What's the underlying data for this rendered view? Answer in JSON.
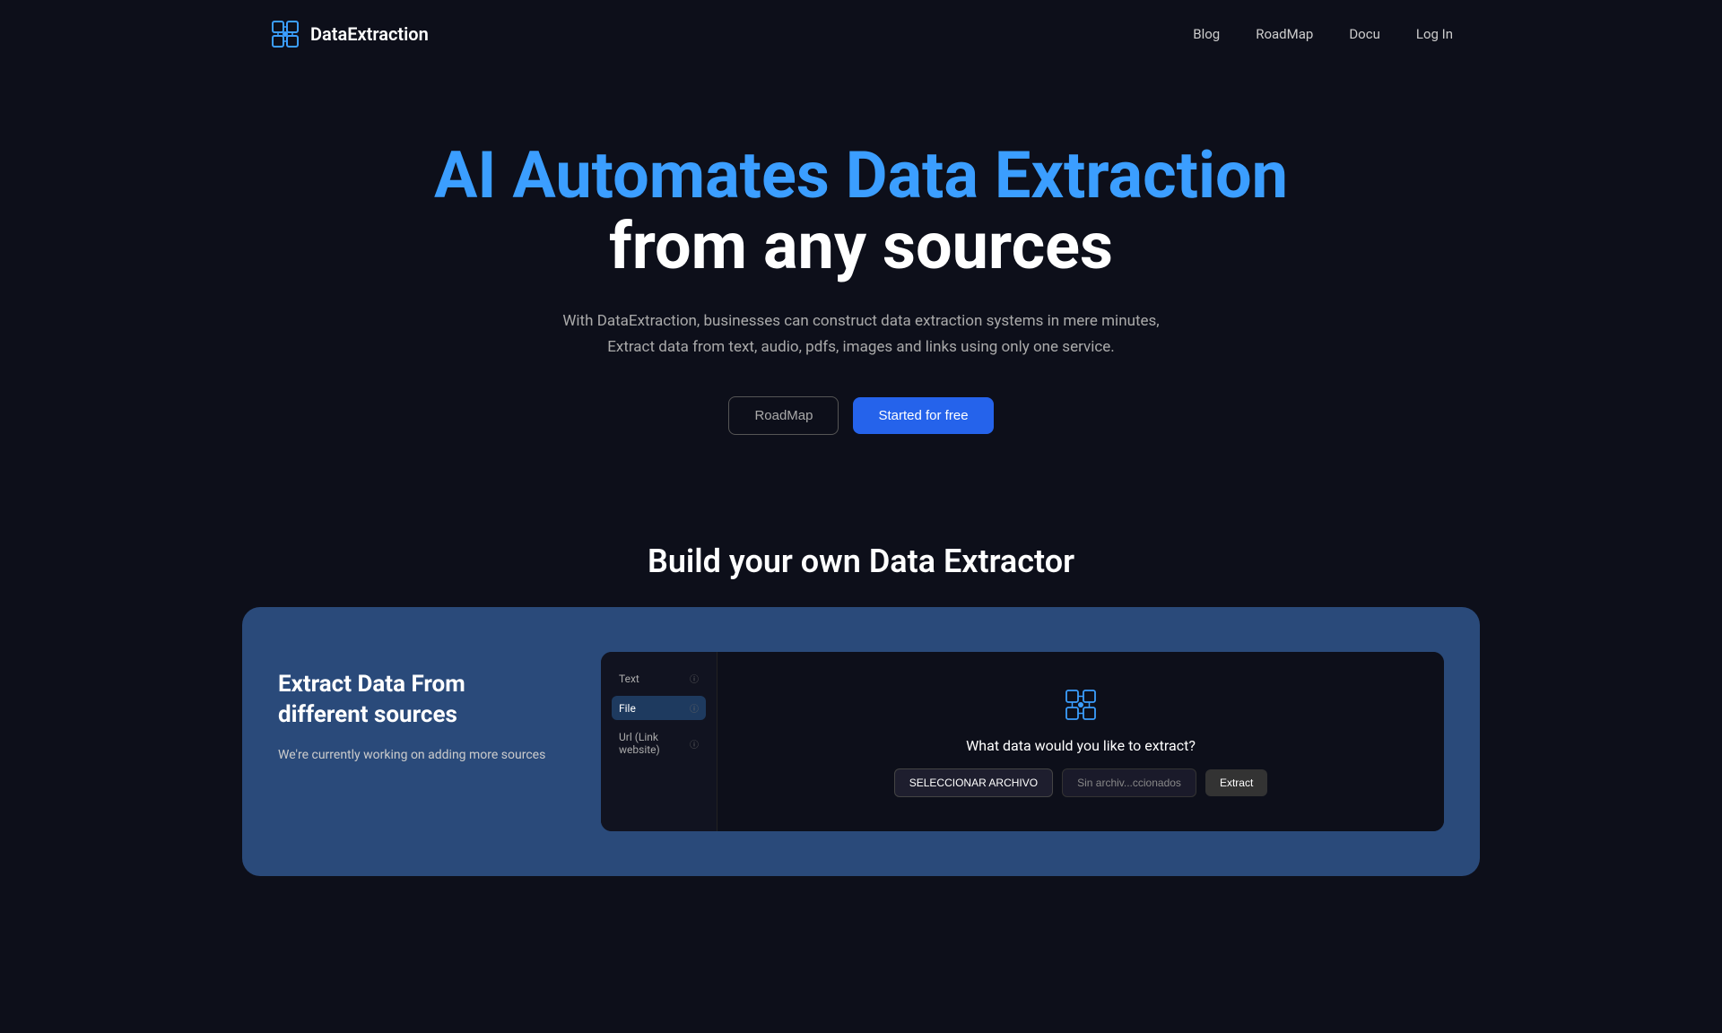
{
  "navbar": {
    "logo_text": "DataExtraction",
    "links": [
      {
        "label": "Blog",
        "id": "blog"
      },
      {
        "label": "RoadMap",
        "id": "roadmap"
      },
      {
        "label": "Docu",
        "id": "docu"
      },
      {
        "label": "Log In",
        "id": "login"
      }
    ]
  },
  "hero": {
    "title_line1": "AI Automates Data Extraction",
    "title_line2": "from any sources",
    "subtitle": "With DataExtraction, businesses can construct data extraction systems in mere minutes, Extract data from text, audio, pdfs, images and links using only one service.",
    "btn_roadmap": "RoadMap",
    "btn_started": "Started for free"
  },
  "section": {
    "title": "Build your own Data Extractor"
  },
  "demo": {
    "left_title": "Extract Data From different sources",
    "left_subtitle": "We're currently working on adding more sources",
    "mock_sidebar_items": [
      {
        "label": "Text"
      },
      {
        "label": "File"
      },
      {
        "label": "Url (Link website)"
      }
    ],
    "mock_question": "What data would you like to extract?",
    "mock_btn_select": "SELECCIONAR ARCHIVO",
    "mock_btn_no_file": "Sin archiv...ccionados",
    "mock_btn_extract": "Extract"
  },
  "colors": {
    "bg": "#0d0f1a",
    "accent_blue": "#3b9eff",
    "btn_blue": "#2563eb",
    "demo_bg": "#2a4a7a"
  }
}
